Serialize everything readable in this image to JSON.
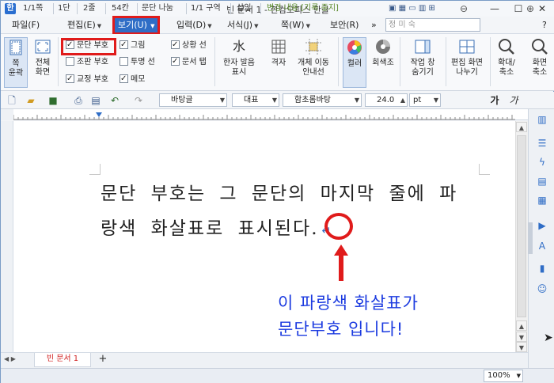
{
  "window": {
    "title": "빈 문서 1 - 한컴오피스 한글",
    "minimize": "—",
    "maximize": "☐",
    "close": "✕"
  },
  "menu": {
    "items": [
      {
        "label": "파일(F)"
      },
      {
        "label": "편집(E)"
      },
      {
        "label": "보기(U)"
      },
      {
        "label": "입력(D)"
      },
      {
        "label": "서식(J)"
      },
      {
        "label": "쪽(W)"
      },
      {
        "label": "보안(R)"
      }
    ],
    "more": "»",
    "name_placeholder": "정 미 숙",
    "help": "?"
  },
  "ribbon": {
    "page_fit": "쪽\n윤곽",
    "full_screen": "전체\n화면",
    "checks": [
      {
        "label": "문단 부호",
        "checked": true
      },
      {
        "label": "조판 부호",
        "checked": false
      },
      {
        "label": "교정 부호",
        "checked": true
      },
      {
        "label": "그림",
        "checked": true
      },
      {
        "label": "투명 선",
        "checked": false
      },
      {
        "label": "메모",
        "checked": true
      },
      {
        "label": "상황 선",
        "checked": true
      },
      {
        "label": "문서 탭",
        "checked": true
      }
    ],
    "hanja": "한자 발음\n표시",
    "grid": "격자",
    "object_move": "개체 이동\n안내선",
    "color": "컬러",
    "grayscale": "회색조",
    "hide_window": "작업 창\n숨기기",
    "split_edit": "편집 화면\n나누기",
    "zoom": "확대/\n축소",
    "fit_width": "화면\n축소"
  },
  "toolbar": {
    "style": "바탕글",
    "lang": "대표",
    "font": "함초롬바탕",
    "size": "24.0",
    "unit": "pt",
    "bold": "가",
    "italic": "가"
  },
  "document": {
    "line1": "문단 부호는 그 문단의 마지막 줄에 파",
    "line2": "랑색 화살표로 표시된다.",
    "para_mark": "↵",
    "caption_line1": "이 파랑색 화살표가",
    "caption_line2": "문단부호 입니다!"
  },
  "tabs": {
    "doc_tab": "빈 문서 1",
    "add": "+"
  },
  "status": {
    "page": "1/1쪽",
    "section": "1단",
    "line": "2줄",
    "col": "54칸",
    "para_break": "문단 나눔",
    "area": "1/1 구역",
    "insert": "삽입",
    "track": "변경 내용 [기록 중지]",
    "zoom": "100%"
  }
}
